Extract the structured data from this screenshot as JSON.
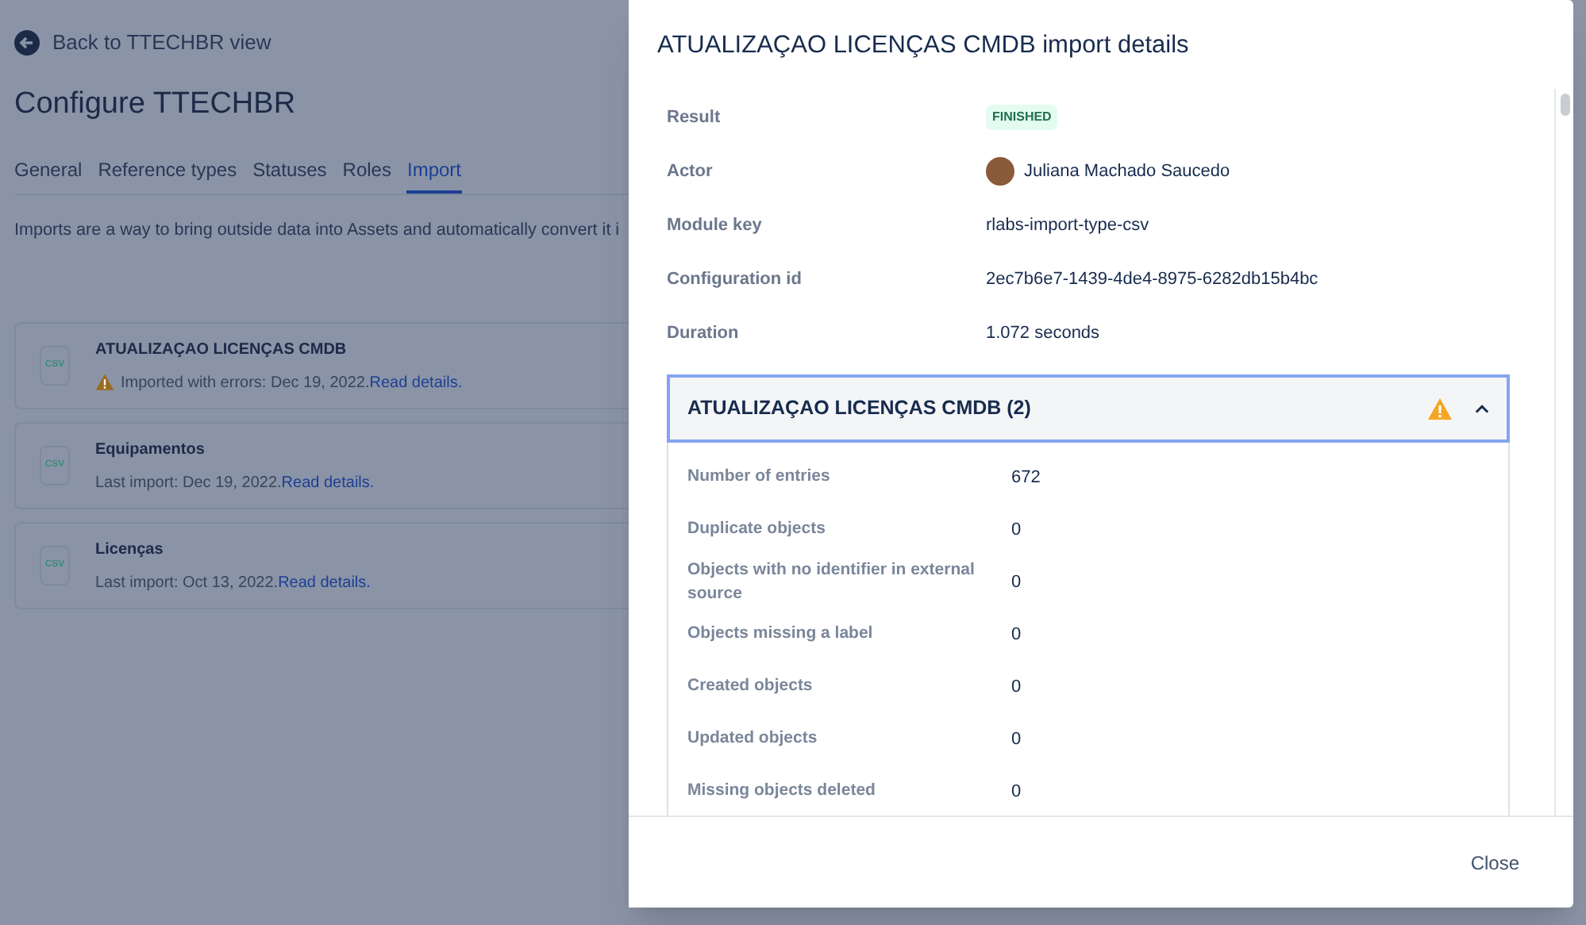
{
  "page": {
    "back_link": "Back to TTECHBR view",
    "title": "Configure TTECHBR",
    "tabs": [
      {
        "label": "General",
        "selected": false
      },
      {
        "label": "Reference types",
        "selected": false
      },
      {
        "label": "Statuses",
        "selected": false
      },
      {
        "label": "Roles",
        "selected": false
      },
      {
        "label": "Import",
        "selected": true
      }
    ],
    "description": "Imports are a way to bring outside data into Assets and automatically convert it i",
    "imports": [
      {
        "name": "ATUALIZAÇAO LICENÇAS CMDB",
        "file_type": "CSV",
        "kind": "error",
        "status": "Imported with errors: Dec 19, 2022.",
        "link": "Read details."
      },
      {
        "name": "Equipamentos",
        "file_type": "CSV",
        "kind": "normal",
        "status": "Last import: Dec 19, 2022.",
        "link": "Read details."
      },
      {
        "name": "Licenças",
        "file_type": "CSV",
        "kind": "normal",
        "status": "Last import: Oct 13, 2022.",
        "link": "Read details."
      }
    ]
  },
  "dialog": {
    "title": "ATUALIZAÇAO LICENÇAS CMDB import details",
    "details": [
      {
        "label": "Result",
        "value": "FINISHED",
        "kind": "lozenge"
      },
      {
        "label": "Actor",
        "value": "Juliana Machado Saucedo",
        "kind": "user"
      },
      {
        "label": "Module key",
        "value": "rlabs-import-type-csv",
        "kind": "text"
      },
      {
        "label": "Configuration id",
        "value": "2ec7b6e7-1439-4de4-8975-6282db15b4bc",
        "kind": "text"
      },
      {
        "label": "Duration",
        "value": "1.072 seconds",
        "kind": "text"
      }
    ],
    "section": {
      "title": "ATUALIZAÇAO LICENÇAS CMDB (2)",
      "warning": true,
      "expanded": true,
      "rows": [
        {
          "label": "Number of entries",
          "value": "672"
        },
        {
          "label": "Duplicate objects",
          "value": "0"
        },
        {
          "label": "Objects with no identifier in external source",
          "value": "0"
        },
        {
          "label": "Objects missing a label",
          "value": "0"
        },
        {
          "label": "Created objects",
          "value": "0"
        },
        {
          "label": "Updated objects",
          "value": "0"
        },
        {
          "label": "Missing objects deleted",
          "value": "0"
        }
      ]
    },
    "close_button": "Close"
  }
}
